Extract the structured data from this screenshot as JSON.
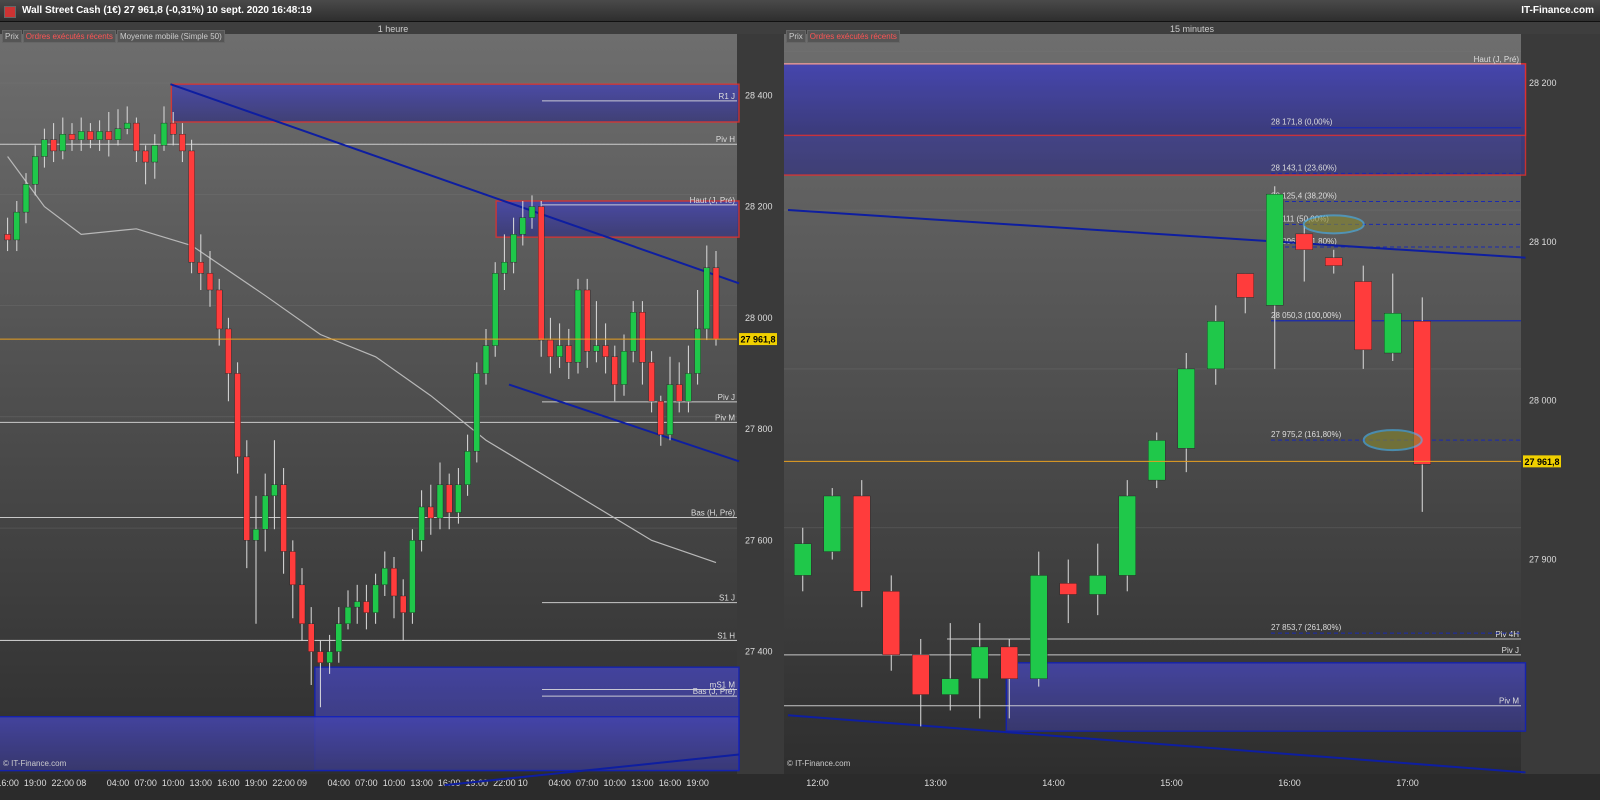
{
  "header": {
    "title": "Wall Street Cash (1€)   27 961,8 (-0,31%)   10 sept. 2020 16:48:19",
    "brand": "IT-Finance.com"
  },
  "colors": {
    "up": "#1fc84a",
    "down": "#ff3c3c",
    "trend": "#0e1ea0",
    "zone": "#3a3c9a",
    "last": "#f0d000",
    "pivot": "#e0e0e0",
    "ma": "#b8b8b8"
  },
  "chart_data": [
    {
      "type": "candlestick",
      "title": "1 heure",
      "legend": [
        "Prix",
        "Ordres exécutés récents",
        "Moyenne mobile (Simple 50)"
      ],
      "copyright": "© IT-Finance.com",
      "y_ticks": [
        {
          "value": 28400,
          "label": "28 400"
        },
        {
          "value": 28200,
          "label": "28 200"
        },
        {
          "value": 28000,
          "label": "28 000"
        },
        {
          "value": 27800,
          "label": "27 800"
        },
        {
          "value": 27600,
          "label": "27 600"
        },
        {
          "value": 27400,
          "label": "27 400"
        }
      ],
      "ylim": [
        27180,
        28485
      ],
      "last_price": {
        "value": 27961.8,
        "label": "27 961,8"
      },
      "x_ticks": [
        {
          "i": 0.5,
          "label": "16:00"
        },
        {
          "i": 3.5,
          "label": "19:00"
        },
        {
          "i": 6.5,
          "label": "22:00"
        },
        {
          "i": 8.5,
          "label": "08"
        },
        {
          "i": 12.5,
          "label": "04:00"
        },
        {
          "i": 15.5,
          "label": "07:00"
        },
        {
          "i": 18.5,
          "label": "10:00"
        },
        {
          "i": 21.5,
          "label": "13:00"
        },
        {
          "i": 24.5,
          "label": "16:00"
        },
        {
          "i": 27.5,
          "label": "19:00"
        },
        {
          "i": 30.5,
          "label": "22:00"
        },
        {
          "i": 32.5,
          "label": "09"
        },
        {
          "i": 36.5,
          "label": "04:00"
        },
        {
          "i": 39.5,
          "label": "07:00"
        },
        {
          "i": 42.5,
          "label": "10:00"
        },
        {
          "i": 45.5,
          "label": "13:00"
        },
        {
          "i": 48.5,
          "label": "16:00"
        },
        {
          "i": 51.5,
          "label": "19:00"
        },
        {
          "i": 54.5,
          "label": "22:00"
        },
        {
          "i": 56.5,
          "label": "10"
        },
        {
          "i": 60.5,
          "label": "04:00"
        },
        {
          "i": 63.5,
          "label": "07:00"
        },
        {
          "i": 66.5,
          "label": "10:00"
        },
        {
          "i": 69.5,
          "label": "13:00"
        },
        {
          "i": 72.5,
          "label": "16:00"
        },
        {
          "i": 75.5,
          "label": "19:00"
        }
      ],
      "levels": [
        {
          "name": "R1 J",
          "value": 28390,
          "short": true
        },
        {
          "name": "Piv H",
          "value": 28312,
          "short": false
        },
        {
          "name": "Haut (J, Pré)",
          "value": 28203,
          "short": true
        },
        {
          "name": "Piv J",
          "value": 27849,
          "short": true
        },
        {
          "name": "Piv M",
          "value": 27812,
          "short": false
        },
        {
          "name": "Bas (H, Pré)",
          "value": 27641,
          "short": false
        },
        {
          "name": "S1 J",
          "value": 27488,
          "short": true
        },
        {
          "name": "S1 H",
          "value": 27420,
          "short": false
        },
        {
          "name": "mS1 M",
          "value": 27332,
          "short": true
        },
        {
          "name": "Bas (J, Pré)",
          "value": 27320,
          "short": true
        }
      ],
      "candles": [
        [
          28150,
          28140,
          28180,
          28120
        ],
        [
          28140,
          28190,
          28210,
          28120
        ],
        [
          28190,
          28240,
          28260,
          28170
        ],
        [
          28240,
          28290,
          28310,
          28220
        ],
        [
          28290,
          28320,
          28340,
          28270
        ],
        [
          28320,
          28300,
          28350,
          28280
        ],
        [
          28300,
          28330,
          28360,
          28285
        ],
        [
          28330,
          28320,
          28350,
          28300
        ],
        [
          28320,
          28335,
          28360,
          28300
        ],
        [
          28335,
          28320,
          28350,
          28305
        ],
        [
          28320,
          28335,
          28355,
          28300
        ],
        [
          28335,
          28320,
          28370,
          28290
        ],
        [
          28320,
          28340,
          28375,
          28310
        ],
        [
          28340,
          28350,
          28380,
          28330
        ],
        [
          28350,
          28300,
          28360,
          28280
        ],
        [
          28300,
          28280,
          28310,
          28240
        ],
        [
          28280,
          28310,
          28330,
          28250
        ],
        [
          28310,
          28350,
          28380,
          28300
        ],
        [
          28350,
          28330,
          28370,
          28310
        ],
        [
          28330,
          28300,
          28350,
          28280
        ],
        [
          28300,
          28100,
          28320,
          28080
        ],
        [
          28100,
          28080,
          28150,
          28050
        ],
        [
          28080,
          28050,
          28120,
          28020
        ],
        [
          28050,
          27980,
          28070,
          27950
        ],
        [
          27980,
          27900,
          28000,
          27850
        ],
        [
          27900,
          27750,
          27920,
          27720
        ],
        [
          27750,
          27600,
          27780,
          27550
        ],
        [
          27600,
          27620,
          27680,
          27450
        ],
        [
          27620,
          27680,
          27720,
          27580
        ],
        [
          27680,
          27700,
          27780,
          27620
        ],
        [
          27700,
          27580,
          27730,
          27540
        ],
        [
          27580,
          27520,
          27600,
          27460
        ],
        [
          27520,
          27450,
          27550,
          27420
        ],
        [
          27450,
          27400,
          27480,
          27340
        ],
        [
          27400,
          27380,
          27420,
          27300
        ],
        [
          27380,
          27400,
          27430,
          27360
        ],
        [
          27400,
          27450,
          27480,
          27380
        ],
        [
          27450,
          27480,
          27510,
          27440
        ],
        [
          27480,
          27490,
          27520,
          27450
        ],
        [
          27490,
          27470,
          27520,
          27440
        ],
        [
          27470,
          27520,
          27540,
          27450
        ],
        [
          27520,
          27550,
          27580,
          27500
        ],
        [
          27550,
          27500,
          27570,
          27460
        ],
        [
          27500,
          27470,
          27530,
          27420
        ],
        [
          27470,
          27600,
          27620,
          27450
        ],
        [
          27600,
          27660,
          27690,
          27580
        ],
        [
          27660,
          27640,
          27700,
          27610
        ],
        [
          27640,
          27700,
          27740,
          27620
        ],
        [
          27700,
          27650,
          27720,
          27620
        ],
        [
          27650,
          27700,
          27730,
          27630
        ],
        [
          27700,
          27760,
          27790,
          27680
        ],
        [
          27760,
          27900,
          27920,
          27740
        ],
        [
          27900,
          27950,
          27980,
          27880
        ],
        [
          27950,
          28080,
          28100,
          27930
        ],
        [
          28080,
          28100,
          28150,
          28050
        ],
        [
          28100,
          28150,
          28180,
          28080
        ],
        [
          28150,
          28180,
          28210,
          28130
        ],
        [
          28180,
          28200,
          28220,
          28160
        ],
        [
          28200,
          27960,
          28210,
          27930
        ],
        [
          27960,
          27930,
          28000,
          27900
        ],
        [
          27930,
          27950,
          27990,
          27910
        ],
        [
          27950,
          27920,
          27980,
          27890
        ],
        [
          27920,
          28050,
          28070,
          27900
        ],
        [
          28050,
          27940,
          28070,
          27910
        ],
        [
          27940,
          27950,
          28030,
          27920
        ],
        [
          27950,
          27930,
          27990,
          27900
        ],
        [
          27930,
          27880,
          27950,
          27850
        ],
        [
          27880,
          27940,
          27970,
          27860
        ],
        [
          27940,
          28010,
          28030,
          27920
        ],
        [
          28010,
          27920,
          28030,
          27880
        ],
        [
          27920,
          27850,
          27940,
          27830
        ],
        [
          27850,
          27790,
          27860,
          27770
        ],
        [
          27790,
          27880,
          27930,
          27780
        ],
        [
          27880,
          27850,
          27920,
          27830
        ],
        [
          27850,
          27900,
          27950,
          27830
        ],
        [
          27900,
          27980,
          28050,
          27880
        ],
        [
          27980,
          28090,
          28130,
          27960
        ],
        [
          28090,
          27962,
          28120,
          27950
        ]
      ],
      "ma": [
        [
          0,
          28290
        ],
        [
          4,
          28200
        ],
        [
          8,
          28150
        ],
        [
          14,
          28160
        ],
        [
          20,
          28130
        ],
        [
          28,
          28040
        ],
        [
          34,
          27970
        ],
        [
          40,
          27930
        ],
        [
          46,
          27860
        ],
        [
          52,
          27780
        ],
        [
          58,
          27720
        ],
        [
          64,
          27660
        ],
        [
          70,
          27600
        ],
        [
          77,
          27560
        ]
      ]
    },
    {
      "type": "candlestick",
      "title": "15 minutes",
      "legend": [
        "Prix",
        "Ordres exécutés récents"
      ],
      "copyright": "© IT-Finance.com",
      "y_ticks": [
        {
          "value": 28200,
          "label": "28 200"
        },
        {
          "value": 28100,
          "label": "28 100"
        },
        {
          "value": 28000,
          "label": "28 000"
        },
        {
          "value": 27900,
          "label": "27 900"
        }
      ],
      "ylim": [
        27765,
        28222
      ],
      "last_price": {
        "value": 27961.8,
        "label": "27 961,8"
      },
      "x_ticks": [
        {
          "i": 1.0,
          "label": "12:00"
        },
        {
          "i": 5.0,
          "label": "13:00"
        },
        {
          "i": 9.0,
          "label": "14:00"
        },
        {
          "i": 13.0,
          "label": "15:00"
        },
        {
          "i": 17.0,
          "label": "16:00"
        },
        {
          "i": 21.0,
          "label": "17:00"
        }
      ],
      "levels": [
        {
          "name": "Haut (J, Pré)",
          "value": 28212,
          "short": false
        },
        {
          "name": "Piv 4H",
          "value": 27850,
          "short": true
        },
        {
          "name": "Piv J",
          "value": 27840,
          "short": false
        },
        {
          "name": "Piv M",
          "value": 27808,
          "short": false
        }
      ],
      "fib": [
        {
          "label": "28 171,8 (0,00%)",
          "value": 28171.8
        },
        {
          "label": "28 143,1 (23,60%)",
          "value": 28143.1
        },
        {
          "label": "28 125,4 (38,20%)",
          "value": 28125.4
        },
        {
          "label": "28 111 (50,00%)",
          "value": 28111
        },
        {
          "label": "28 096,7 (61,80%)",
          "value": 28096.7
        },
        {
          "label": "28 050,3 (100,00%)",
          "value": 28050.3
        },
        {
          "label": "27 975,2 (161,80%)",
          "value": 27975.2
        },
        {
          "label": "27 853,7 (261,80%)",
          "value": 27853.7
        }
      ],
      "candles": [
        [
          27890,
          27910,
          27920,
          27880
        ],
        [
          27905,
          27940,
          27945,
          27900
        ],
        [
          27940,
          27880,
          27950,
          27870
        ],
        [
          27880,
          27840,
          27890,
          27830
        ],
        [
          27840,
          27815,
          27850,
          27795
        ],
        [
          27815,
          27825,
          27860,
          27805
        ],
        [
          27825,
          27845,
          27860,
          27800
        ],
        [
          27845,
          27825,
          27850,
          27800
        ],
        [
          27825,
          27890,
          27905,
          27820
        ],
        [
          27885,
          27878,
          27900,
          27860
        ],
        [
          27878,
          27890,
          27910,
          27865
        ],
        [
          27890,
          27940,
          27950,
          27880
        ],
        [
          27950,
          27975,
          27980,
          27945
        ],
        [
          27970,
          28020,
          28030,
          27955
        ],
        [
          28020,
          28050,
          28060,
          28010
        ],
        [
          28080,
          28065,
          28080,
          28055
        ],
        [
          28060,
          28130,
          28135,
          28020
        ],
        [
          28105,
          28095,
          28110,
          28075
        ],
        [
          28090,
          28085,
          28095,
          28080
        ],
        [
          28075,
          28032,
          28085,
          28020
        ],
        [
          28030,
          28055,
          28080,
          28025
        ],
        [
          28050,
          27960,
          28065,
          27930
        ]
      ]
    }
  ]
}
